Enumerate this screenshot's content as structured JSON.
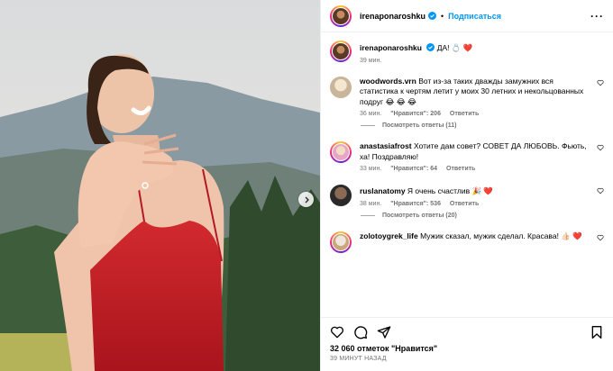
{
  "post": {
    "author": "irenaponaroshku",
    "follow_label": "Подписаться",
    "separator": "•",
    "more": "···"
  },
  "caption": {
    "author": "irenaponaroshku",
    "text": "ДА! 💍 ❤️",
    "time": "39 мин."
  },
  "comments": [
    {
      "user": "woodwords.vrn",
      "text": "Вот из-за таких дважды замужних вся статистика к чертям летит у моих 30 летних и нeкольцованных подруг 😂 😂 😂",
      "time": "36 мин.",
      "likes": "\"Нравится\": 206",
      "reply": "Ответить",
      "replies": "Посмотреть ответы (11)"
    },
    {
      "user": "anastasiafrost",
      "text": "Хотите дам совет? СОВЕТ ДА ЛЮБОВЬ. Фьють, ха! Поздравляю!",
      "time": "33 мин.",
      "likes": "\"Нравится\": 64",
      "reply": "Ответить",
      "replies": ""
    },
    {
      "user": "ruslanatomy",
      "text": "Я очень счастлив 🎉 ❤️",
      "time": "38 мин.",
      "likes": "\"Нравится\": 536",
      "reply": "Ответить",
      "replies": "Посмотреть ответы (20)"
    },
    {
      "user": "zolotoygrek_life",
      "text": "Мужик сказал, мужик сделал. Красава! 👍🏻 ❤️",
      "time": "",
      "likes": "",
      "reply": "",
      "replies": ""
    }
  ],
  "footer": {
    "likes": "32 060 отметок \"Нравится\"",
    "time_ago": "39 МИНУТ НАЗАД"
  },
  "icons": {
    "heart": "heart-icon",
    "comment": "comment-icon",
    "share": "share-icon",
    "save": "bookmark-icon",
    "verified": "verified-badge-icon",
    "next": "chevron-right-icon"
  },
  "colors": {
    "link_blue": "#0095f6",
    "verified_blue": "#0095f6",
    "dress_red": "#c8232c"
  }
}
